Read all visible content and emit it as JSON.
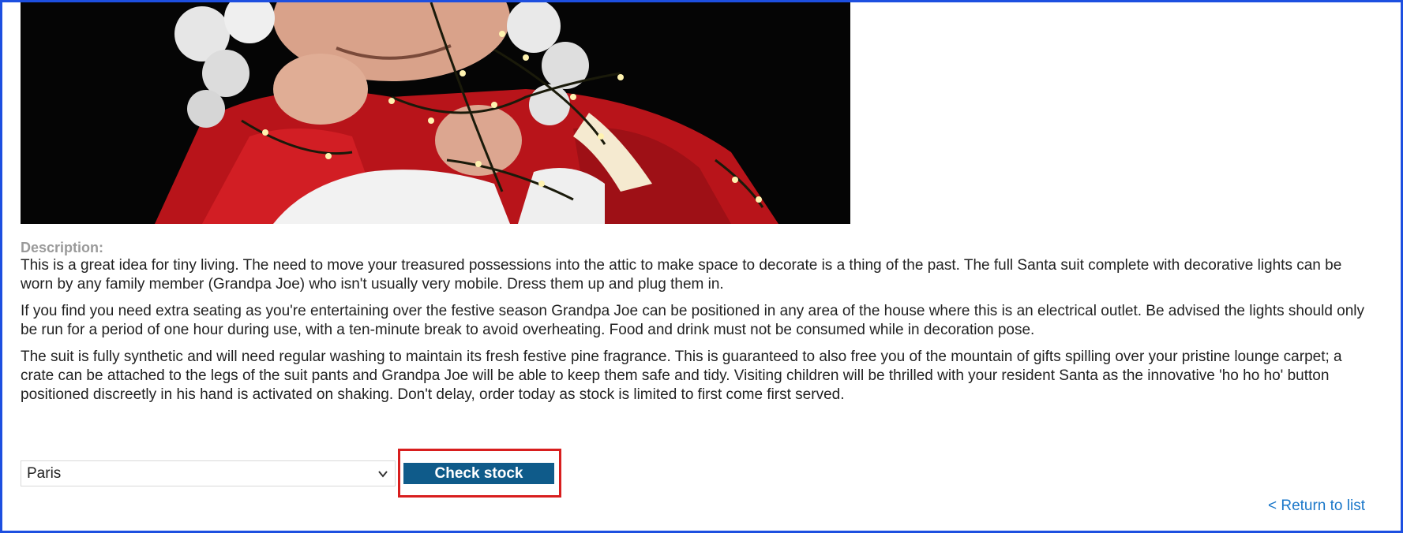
{
  "product": {
    "image_alt": "Man dressed as Santa wrapped in fairy lights",
    "description_heading": "Description:",
    "paragraphs": [
      "This is a great idea for tiny living. The need to move your treasured possessions into the attic to make space to decorate is a thing of the past. The full Santa suit complete with decorative lights can be worn by any family member (Grandpa Joe) who isn't usually very mobile. Dress them up and plug them in.",
      "If you find you need extra seating as you're entertaining over the festive season Grandpa Joe can be positioned in any area of the house where this is an electrical outlet. Be advised the lights should only be run for a period of one hour during use, with a ten-minute break to avoid overheating. Food and drink must not be consumed while in decoration pose.",
      "The suit is fully synthetic and will need regular washing to maintain its fresh festive pine fragrance. This is guaranteed to also free you of the mountain of gifts spilling over your pristine lounge carpet; a crate can be attached to the legs of the suit pants and Grandpa Joe will be able to keep them safe and tidy. Visiting children will be thrilled with your resident Santa as the innovative 'ho ho ho' button positioned discreetly in his hand is activated on shaking. Don't delay, order today as stock is limited to first come first served."
    ]
  },
  "stock_check": {
    "selected_store": "Paris",
    "button_label": "Check stock"
  },
  "navigation": {
    "return_link": "< Return to list"
  },
  "colors": {
    "frame_border": "#1d4fe0",
    "button_bg": "#0f5b8a",
    "highlight": "#d81e1e",
    "link": "#1a77c9"
  },
  "icons": {
    "select_arrow": "chevron-down-icon"
  }
}
